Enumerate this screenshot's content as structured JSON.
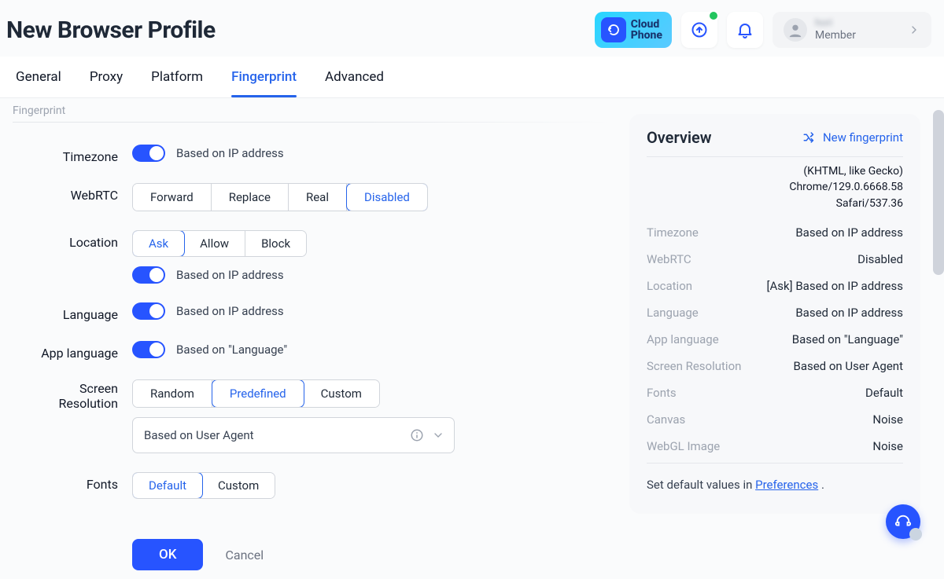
{
  "header": {
    "title": "New Browser Profile",
    "cloud_phone_line1": "Cloud",
    "cloud_phone_line2": "Phone",
    "member_name": "hori",
    "member_role": "Member"
  },
  "tabs": [
    "General",
    "Proxy",
    "Platform",
    "Fingerprint",
    "Advanced"
  ],
  "active_tab": 3,
  "section_heading": "Fingerprint",
  "form": {
    "timezone": {
      "label": "Timezone",
      "toggle_text": "Based on IP address"
    },
    "webrtc": {
      "label": "WebRTC",
      "options": [
        "Forward",
        "Replace",
        "Real",
        "Disabled"
      ],
      "selected": 3
    },
    "location": {
      "label": "Location",
      "options": [
        "Ask",
        "Allow",
        "Block"
      ],
      "selected": 0,
      "toggle_text": "Based on IP address"
    },
    "language": {
      "label": "Language",
      "toggle_text": "Based on IP address"
    },
    "app_language": {
      "label": "App language",
      "toggle_text": "Based on \"Language\""
    },
    "screen_res": {
      "label": "Screen Resolution",
      "options": [
        "Random",
        "Predefined",
        "Custom"
      ],
      "selected": 1,
      "select_value": "Based on User Agent"
    },
    "fonts": {
      "label": "Fonts",
      "options": [
        "Default",
        "Custom"
      ],
      "selected": 0
    }
  },
  "overview": {
    "heading": "Overview",
    "new_fingerprint": "New fingerprint",
    "ua_lines": [
      "(KHTML, like Gecko)",
      "Chrome/129.0.6668.58",
      "Safari/537.36"
    ],
    "pairs": [
      {
        "k": "Timezone",
        "v": "Based on IP address"
      },
      {
        "k": "WebRTC",
        "v": "Disabled"
      },
      {
        "k": "Location",
        "v": "[Ask] Based on IP address"
      },
      {
        "k": "Language",
        "v": "Based on IP address"
      },
      {
        "k": "App language",
        "v": "Based on \"Language\""
      },
      {
        "k": "Screen Resolution",
        "v": "Based on User Agent"
      },
      {
        "k": "Fonts",
        "v": "Default"
      },
      {
        "k": "Canvas",
        "v": "Noise"
      },
      {
        "k": "WebGL Image",
        "v": "Noise"
      }
    ],
    "pref_prefix": "Set default values in ",
    "pref_link": "Preferences",
    "pref_suffix": " ."
  },
  "actions": {
    "ok": "OK",
    "cancel": "Cancel"
  }
}
